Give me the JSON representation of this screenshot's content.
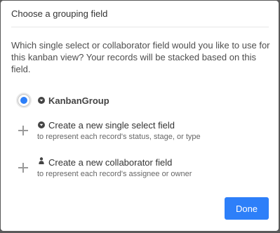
{
  "dialog": {
    "title": "Choose a grouping field",
    "description": "Which single select or collaborator field would you like to use for this kanban view? Your records will be stacked based on this field."
  },
  "options": [
    {
      "label": "KanbanGroup",
      "icon": "single-select-icon",
      "selected": true
    },
    {
      "label": "Create a new single select field",
      "sublabel": "to represent each record's status, stage, or type",
      "icon": "single-select-icon",
      "action": "plus-icon"
    },
    {
      "label": "Create a new collaborator field",
      "sublabel": "to represent each record's assignee or owner",
      "icon": "person-icon",
      "action": "plus-icon"
    }
  ],
  "done_label": "Done",
  "colors": {
    "accent": "#2d7ff9",
    "backdrop": "#5a5a5a",
    "icon": "#444444"
  }
}
